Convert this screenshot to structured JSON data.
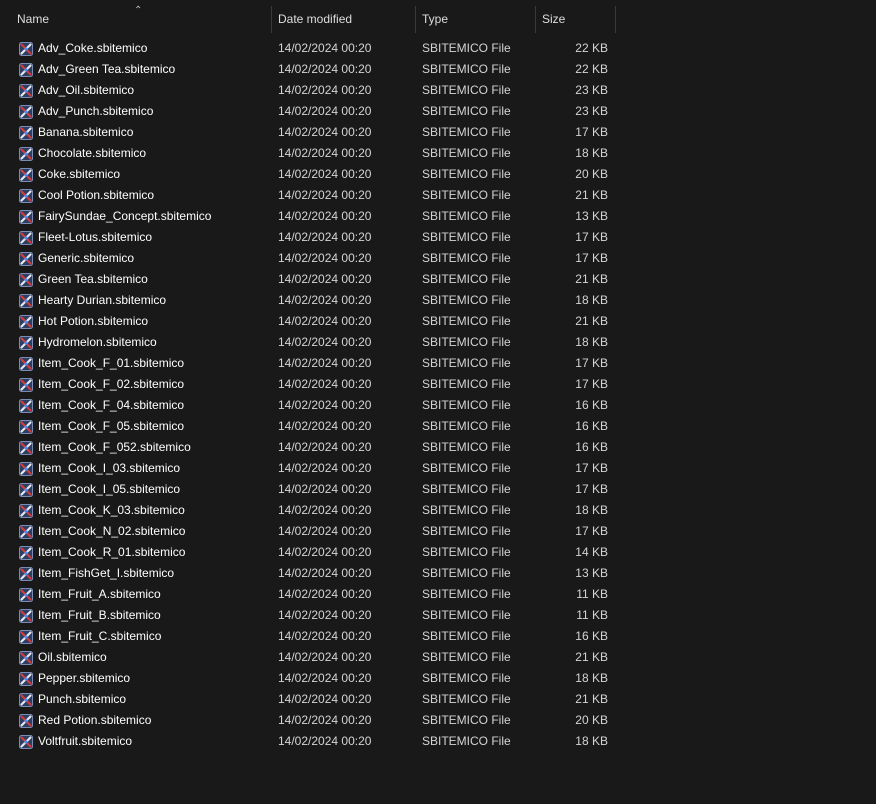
{
  "columns": {
    "name": "Name",
    "date": "Date modified",
    "type": "Type",
    "size": "Size"
  },
  "sort": {
    "column": "name",
    "direction": "ascending"
  },
  "icon": "sbitemico-file-icon",
  "files": [
    {
      "name": "Adv_Coke.sbitemico",
      "date": "14/02/2024 00:20",
      "type": "SBITEMICO File",
      "size": "22 KB"
    },
    {
      "name": "Adv_Green Tea.sbitemico",
      "date": "14/02/2024 00:20",
      "type": "SBITEMICO File",
      "size": "22 KB"
    },
    {
      "name": "Adv_Oil.sbitemico",
      "date": "14/02/2024 00:20",
      "type": "SBITEMICO File",
      "size": "23 KB"
    },
    {
      "name": "Adv_Punch.sbitemico",
      "date": "14/02/2024 00:20",
      "type": "SBITEMICO File",
      "size": "23 KB"
    },
    {
      "name": "Banana.sbitemico",
      "date": "14/02/2024 00:20",
      "type": "SBITEMICO File",
      "size": "17 KB"
    },
    {
      "name": "Chocolate.sbitemico",
      "date": "14/02/2024 00:20",
      "type": "SBITEMICO File",
      "size": "18 KB"
    },
    {
      "name": "Coke.sbitemico",
      "date": "14/02/2024 00:20",
      "type": "SBITEMICO File",
      "size": "20 KB"
    },
    {
      "name": "Cool Potion.sbitemico",
      "date": "14/02/2024 00:20",
      "type": "SBITEMICO File",
      "size": "21 KB"
    },
    {
      "name": "FairySundae_Concept.sbitemico",
      "date": "14/02/2024 00:20",
      "type": "SBITEMICO File",
      "size": "13 KB"
    },
    {
      "name": "Fleet-Lotus.sbitemico",
      "date": "14/02/2024 00:20",
      "type": "SBITEMICO File",
      "size": "17 KB"
    },
    {
      "name": "Generic.sbitemico",
      "date": "14/02/2024 00:20",
      "type": "SBITEMICO File",
      "size": "17 KB"
    },
    {
      "name": "Green Tea.sbitemico",
      "date": "14/02/2024 00:20",
      "type": "SBITEMICO File",
      "size": "21 KB"
    },
    {
      "name": "Hearty Durian.sbitemico",
      "date": "14/02/2024 00:20",
      "type": "SBITEMICO File",
      "size": "18 KB"
    },
    {
      "name": "Hot Potion.sbitemico",
      "date": "14/02/2024 00:20",
      "type": "SBITEMICO File",
      "size": "21 KB"
    },
    {
      "name": "Hydromelon.sbitemico",
      "date": "14/02/2024 00:20",
      "type": "SBITEMICO File",
      "size": "18 KB"
    },
    {
      "name": "Item_Cook_F_01.sbitemico",
      "date": "14/02/2024 00:20",
      "type": "SBITEMICO File",
      "size": "17 KB"
    },
    {
      "name": "Item_Cook_F_02.sbitemico",
      "date": "14/02/2024 00:20",
      "type": "SBITEMICO File",
      "size": "17 KB"
    },
    {
      "name": "Item_Cook_F_04.sbitemico",
      "date": "14/02/2024 00:20",
      "type": "SBITEMICO File",
      "size": "16 KB"
    },
    {
      "name": "Item_Cook_F_05.sbitemico",
      "date": "14/02/2024 00:20",
      "type": "SBITEMICO File",
      "size": "16 KB"
    },
    {
      "name": "Item_Cook_F_052.sbitemico",
      "date": "14/02/2024 00:20",
      "type": "SBITEMICO File",
      "size": "16 KB"
    },
    {
      "name": "Item_Cook_I_03.sbitemico",
      "date": "14/02/2024 00:20",
      "type": "SBITEMICO File",
      "size": "17 KB"
    },
    {
      "name": "Item_Cook_I_05.sbitemico",
      "date": "14/02/2024 00:20",
      "type": "SBITEMICO File",
      "size": "17 KB"
    },
    {
      "name": "Item_Cook_K_03.sbitemico",
      "date": "14/02/2024 00:20",
      "type": "SBITEMICO File",
      "size": "18 KB"
    },
    {
      "name": "Item_Cook_N_02.sbitemico",
      "date": "14/02/2024 00:20",
      "type": "SBITEMICO File",
      "size": "17 KB"
    },
    {
      "name": "Item_Cook_R_01.sbitemico",
      "date": "14/02/2024 00:20",
      "type": "SBITEMICO File",
      "size": "14 KB"
    },
    {
      "name": "Item_FishGet_I.sbitemico",
      "date": "14/02/2024 00:20",
      "type": "SBITEMICO File",
      "size": "13 KB"
    },
    {
      "name": "Item_Fruit_A.sbitemico",
      "date": "14/02/2024 00:20",
      "type": "SBITEMICO File",
      "size": "11 KB"
    },
    {
      "name": "Item_Fruit_B.sbitemico",
      "date": "14/02/2024 00:20",
      "type": "SBITEMICO File",
      "size": "11 KB"
    },
    {
      "name": "Item_Fruit_C.sbitemico",
      "date": "14/02/2024 00:20",
      "type": "SBITEMICO File",
      "size": "16 KB"
    },
    {
      "name": "Oil.sbitemico",
      "date": "14/02/2024 00:20",
      "type": "SBITEMICO File",
      "size": "21 KB"
    },
    {
      "name": "Pepper.sbitemico",
      "date": "14/02/2024 00:20",
      "type": "SBITEMICO File",
      "size": "18 KB"
    },
    {
      "name": "Punch.sbitemico",
      "date": "14/02/2024 00:20",
      "type": "SBITEMICO File",
      "size": "21 KB"
    },
    {
      "name": "Red Potion.sbitemico",
      "date": "14/02/2024 00:20",
      "type": "SBITEMICO File",
      "size": "20 KB"
    },
    {
      "name": "Voltfruit.sbitemico",
      "date": "14/02/2024 00:20",
      "type": "SBITEMICO File",
      "size": "18 KB"
    }
  ]
}
